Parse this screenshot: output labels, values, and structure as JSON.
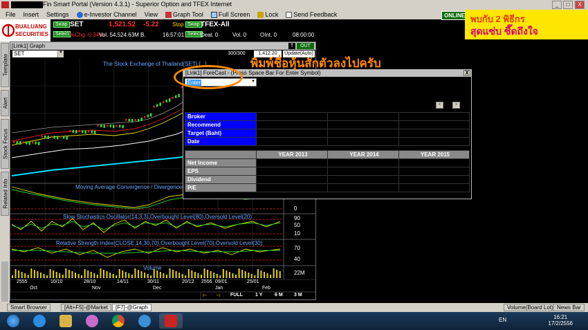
{
  "window": {
    "title": "Fin Smart Portal (Version 4.3.1) - Superior Option and TFEX Internet",
    "minimize": "_",
    "maximize": "□",
    "close": "X"
  },
  "menu": [
    "File",
    "Insert",
    "Settings",
    "e-Investor Channel",
    "View",
    "Graph Tool",
    "Full Screen",
    "Lock",
    "Send Feedback"
  ],
  "online_badge": "ONLINE",
  "ad": {
    "line1": "พบกับ 2 พิธีกร",
    "line2": "สุดแซ่บ ซี๊ดถึงใจ"
  },
  "brand": {
    "name1": "BUALUANG",
    "name2": "SECURITIES"
  },
  "quote_set": {
    "swap": "Swap",
    "select": "Select",
    "symbol": "SET",
    "price": "1,521.52",
    "change": "-5.22",
    "stop": "Stop",
    "pct": "%Chg -0.34%",
    "vol": "Vol. 54,524.63M B.",
    "time": "16:57:01"
  },
  "quote_tfex": {
    "swap": "Swap",
    "select": "Select",
    "symbol": "TFEX-All",
    "deal": "Deal. 0",
    "vol": "Vol. 0",
    "oint": "OInt. 0",
    "time": "08:00:00"
  },
  "sidetabs": [
    "Template",
    "Alert",
    "Stock Focus",
    "Related Info"
  ],
  "graph": {
    "header": "[Link1] Graph",
    "t_btn": "T",
    "out_btn": "OUT",
    "symbol": "SET",
    "count": "300/300",
    "price_box": "1,412.20",
    "update": "Update(Auto)",
    "price_title": "The Stock Exchange of Thailand(SET) [...]",
    "macd_title": "Moving Average Convergence / Divergence(26",
    "sto_title": "Slow Stochastics Oscillator(14,3,3),Overbought Level(80),Oversold Level(20)",
    "rsi_title": "Relative Strength Index(CLOSE,14,30,70),Overbought Level(70),Oversold Level(30)",
    "vol_title": "Volume",
    "macd_axis": [
      "0"
    ],
    "sto_axis": [
      "90",
      "50",
      "10"
    ],
    "rsi_axis": [
      "70",
      "40"
    ],
    "vol_axis": [
      "22M"
    ],
    "dates_top": [
      "2555",
      "10/10",
      "28/10",
      "14/11",
      "30/11",
      "20/12",
      "2556",
      "09/01",
      "25/01"
    ],
    "dates_bot": [
      "Oct",
      "Nov",
      "Dec",
      "Jan",
      "Feb"
    ],
    "ranges": [
      "FULL",
      "1 Y",
      "6 M",
      "3 M"
    ]
  },
  "forecast": {
    "header": "[Link1] ForeCast - (Press Space Bar For Enter Symbol)",
    "close": "X",
    "input_value": "Enter",
    "prev": "<",
    "next": ">",
    "info_rows": [
      "Broker",
      "Recommend",
      "Target (Baht)",
      "Date"
    ],
    "years": [
      "YEAR 2013",
      "YEAR 2014",
      "YEAR 2015"
    ],
    "fin_rows": [
      "Net Income",
      "EPS",
      "Dividend",
      "P/E"
    ]
  },
  "annotation": "พิมพ์ชื่อหุ้นสักตัวลงไปครับ",
  "docbar": {
    "smart_browser": "Smart Browser",
    "market": "[Alt+F5]-@Market",
    "egraph": "[F7]-@Graph",
    "volume": "Volume(Board Lot)",
    "news": "News Bar"
  },
  "taskbar": {
    "lang": "EN",
    "time": "16:21",
    "date": "17/2/2556"
  },
  "colors": {
    "accent_green": "#1a8a1a",
    "forecast_blue": "#0000ff",
    "annotation": "#ff8a00"
  }
}
